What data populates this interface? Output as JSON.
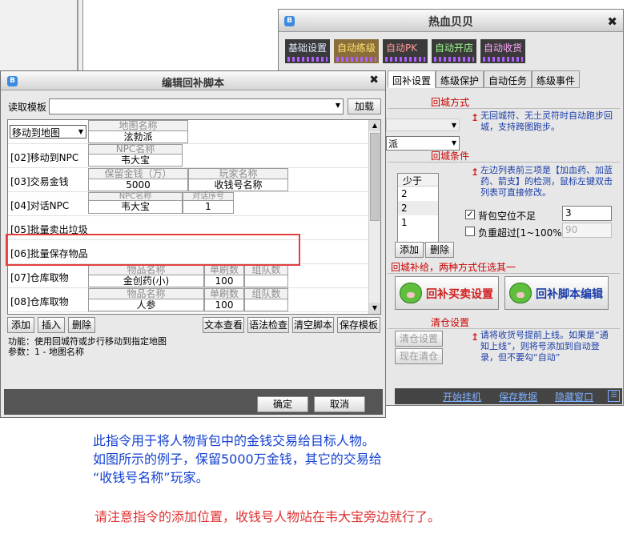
{
  "main_window": {
    "title": "热血贝贝",
    "top_tabs": [
      "基础设置",
      "自动练级",
      "自动PK",
      "自动开店",
      "自动收货"
    ],
    "sub_tabs": [
      "回补设置",
      "练级保护",
      "自动任务",
      "练级事件"
    ],
    "return_method": {
      "title": "回城方式",
      "note": "无回城符、无土灵符时自动跑步回城，支持跨图跑步。",
      "select_value": "派"
    },
    "return_condition": {
      "title": "回城条件",
      "list_header": "少于",
      "list_values": [
        "2",
        "2",
        "1"
      ],
      "note": "左边列表前三项是【加血药、加蓝药、箭支】的检测，鼠标左键双击列表可直接修改。",
      "bag_label": "背包空位不足",
      "bag_checked": "✓",
      "bag_value": "3",
      "overload_label": "负重超过[1~100%]",
      "overload_value": "90",
      "add_button": "添加",
      "delete_button": "删除"
    },
    "resupply": {
      "title": "回城补给，两种方式任选其一",
      "buy_button": "回补买卖设置",
      "script_button": "回补脚本编辑"
    },
    "clear_warehouse": {
      "title": "清仓设置",
      "settings_button": "清仓设置",
      "now_button": "现在清仓",
      "note": "请将收货号提前上线。如果是“通知上线”，则将号添加到自动登录，但不要勾“自动”"
    },
    "bottom_bar": [
      "开始挂机",
      "保存数据",
      "隐藏窗口"
    ]
  },
  "dialog": {
    "title": "编辑回补脚本",
    "template_label": "读取模板",
    "load_button": "加载",
    "rows": [
      {
        "cmd": "移动到地图",
        "params": [
          {
            "header": "地图名称",
            "value": "泫勃派"
          }
        ]
      },
      {
        "cmd": "[02]移动到NPC",
        "params": [
          {
            "header": "NPC名称",
            "value": "韦大宝"
          }
        ]
      },
      {
        "cmd": "[03]交易金钱",
        "params": [
          {
            "header": "保留金钱（万）",
            "value": "5000"
          },
          {
            "header": "玩家名称",
            "value": "收钱号名称"
          }
        ]
      },
      {
        "cmd": "[04]对话NPC",
        "params": [
          {
            "header": "NPC名称",
            "value": "韦大宝"
          },
          {
            "header": "对话序号",
            "value": "1"
          }
        ]
      },
      {
        "cmd": "[05]批量卖出垃圾",
        "params": []
      },
      {
        "cmd": "[06]批量保存物品",
        "params": []
      },
      {
        "cmd": "[07]仓库取物",
        "params": [
          {
            "header": "物品名称",
            "value": "金创药(小)"
          },
          {
            "header": "单刷数",
            "value": "100"
          },
          {
            "header": "组队数",
            "value": ""
          }
        ]
      },
      {
        "cmd": "[08]仓库取物",
        "params": [
          {
            "header": "物品名称",
            "value": "人参"
          },
          {
            "header": "单刷数",
            "value": "100"
          },
          {
            "header": "组队数",
            "value": ""
          }
        ]
      }
    ],
    "toolbar_left": [
      "添加",
      "插入",
      "删除"
    ],
    "toolbar_right": [
      "文本查看",
      "语法检查",
      "清空脚本",
      "保存模板"
    ],
    "func_line": "功能：使用回城符或步行移动到指定地图",
    "param_line": "参数：1 - 地图名称",
    "ok_button": "确定",
    "cancel_button": "取消"
  },
  "explanation": {
    "line1": "此指令用于将人物背包中的金钱交易给目标人物。",
    "line2": "如图所示的例子，保留5000万金钱，其它的交易给",
    "line3": "“收钱号名称”玩家。",
    "warning": "请注意指令的添加位置，收钱号人物站在韦大宝旁边就行了。"
  }
}
